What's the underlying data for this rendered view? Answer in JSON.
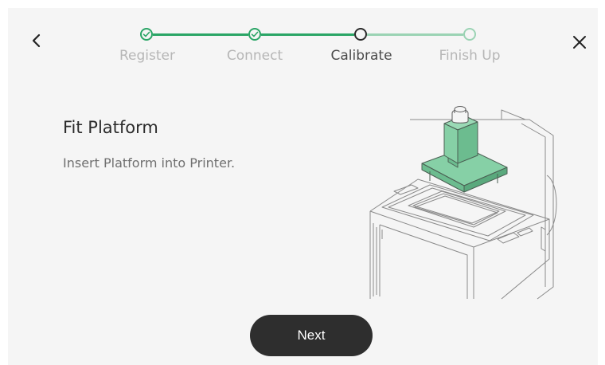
{
  "header": {
    "back_icon": "chevron-left-icon",
    "close_icon": "close-icon"
  },
  "stepper": {
    "steps": [
      {
        "label": "Register",
        "state": "done"
      },
      {
        "label": "Connect",
        "state": "done"
      },
      {
        "label": "Calibrate",
        "state": "current"
      },
      {
        "label": "Finish Up",
        "state": "pending"
      }
    ],
    "done_color": "#2aa566",
    "pending_color": "#9bd3b4"
  },
  "content": {
    "title": "Fit Platform",
    "description": "Insert Platform into Printer.",
    "illustration": "printer-platform-illustration",
    "highlight_color": "#86d0a6"
  },
  "footer": {
    "next_label": "Next"
  }
}
